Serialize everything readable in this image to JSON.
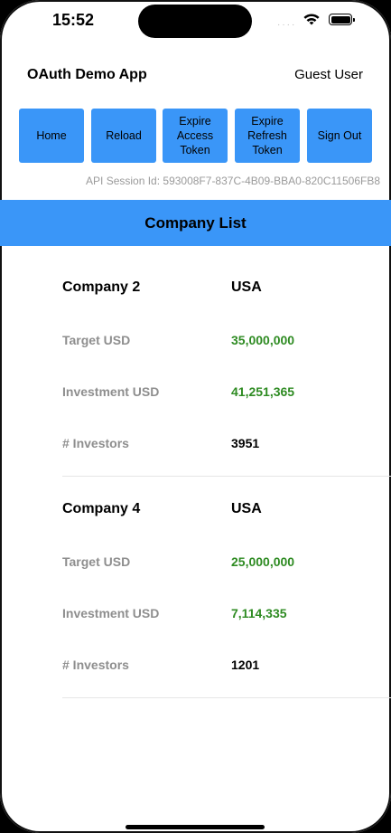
{
  "status_bar": {
    "time": "15:52",
    "signal": "····"
  },
  "header": {
    "title": "OAuth Demo App",
    "user": "Guest User"
  },
  "buttons": [
    {
      "label": "Home"
    },
    {
      "label": "Reload"
    },
    {
      "label": "Expire Access Token"
    },
    {
      "label": "Expire Refresh Token"
    },
    {
      "label": "Sign Out"
    }
  ],
  "session": {
    "text": "API Session Id: 593008F7-837C-4B09-BBA0-820C11506FB8"
  },
  "list": {
    "title": "Company List",
    "companies": [
      {
        "name": "Company 2",
        "country": "USA",
        "target_label": "Target USD",
        "target": "35,000,000",
        "investment_label": "Investment USD",
        "investment": "41,251,365",
        "investors_label": "# Investors",
        "investors": "3951"
      },
      {
        "name": "Company 4",
        "country": "USA",
        "target_label": "Target USD",
        "target": "25,000,000",
        "investment_label": "Investment USD",
        "investment": "7,114,335",
        "investors_label": "# Investors",
        "investors": "1201"
      }
    ]
  },
  "colors": {
    "accent": "#3a96f8",
    "value_green": "#2e8b22",
    "label_gray": "#8e8e8e"
  }
}
